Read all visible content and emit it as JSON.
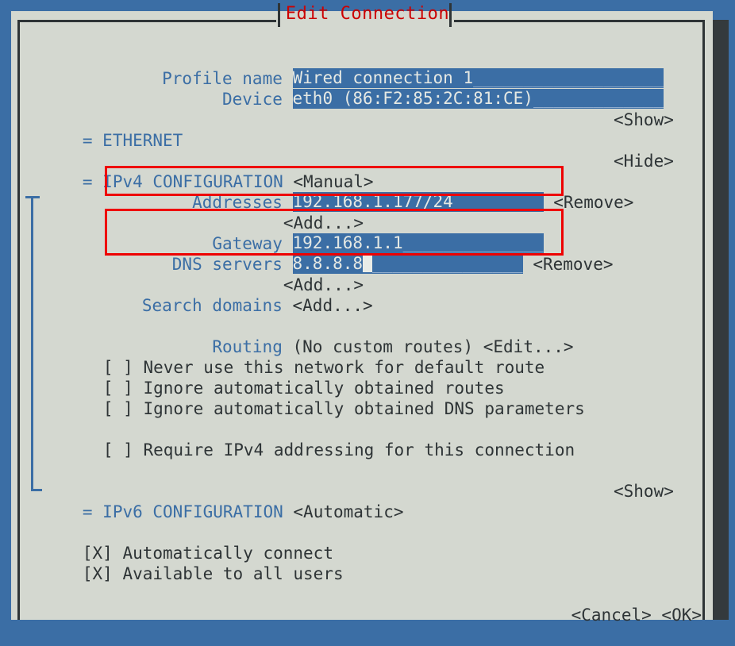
{
  "window": {
    "title": "Edit Connection",
    "app": "nmtui",
    "title_color": "#cc0000",
    "surface_color": "#d4d8d0",
    "accent_color": "#3b6ea5",
    "text_color": "#2e3436",
    "highlight_color": "#ee0000"
  },
  "form": {
    "profile_name": {
      "label": "Profile name",
      "value": "Wired connection 1",
      "fill": "___________________"
    },
    "device": {
      "label": "Device",
      "value": "eth0 (86:F2:85:2C:81:CE)",
      "fill": "_____________"
    }
  },
  "sections": {
    "ethernet": {
      "marker": "=",
      "title": "ETHERNET",
      "toggle": "<Show>"
    },
    "ipv4": {
      "marker": "=",
      "title": "IPv4 CONFIGURATION",
      "mode": "<Manual>",
      "toggle": "<Hide>",
      "addresses": {
        "label": "Addresses",
        "value": "192.168.1.177/24",
        "fill": "_________",
        "remove": "<Remove>",
        "add": "<Add...>"
      },
      "gateway": {
        "label": "Gateway",
        "value": "192.168.1.1",
        "fill": "______________"
      },
      "dns_servers": {
        "label": "DNS servers",
        "value": "8.8.8.8",
        "fill": "_______________",
        "remove": "<Remove>",
        "add": "<Add...>",
        "cursor_after_value": true
      },
      "search_domains": {
        "label": "Search domains",
        "add": "<Add...>"
      },
      "routing": {
        "label": "Routing",
        "value": "(No custom routes)",
        "edit": "<Edit...>"
      },
      "checkboxes": [
        {
          "box": "[ ]",
          "checked": false,
          "label": "Never use this network for default route"
        },
        {
          "box": "[ ]",
          "checked": false,
          "label": "Ignore automatically obtained routes"
        },
        {
          "box": "[ ]",
          "checked": false,
          "label": "Ignore automatically obtained DNS parameters"
        },
        {
          "box": "[ ]",
          "checked": false,
          "label": "Require IPv4 addressing for this connection"
        }
      ]
    },
    "ipv6": {
      "marker": "=",
      "title": "IPv6 CONFIGURATION",
      "mode": "<Automatic>",
      "toggle": "<Show>"
    }
  },
  "global_checkboxes": [
    {
      "box": "[X]",
      "checked": true,
      "label": "Automatically connect"
    },
    {
      "box": "[X]",
      "checked": true,
      "label": "Available to all users"
    }
  ],
  "actions": {
    "cancel": "<Cancel>",
    "ok": "<OK>"
  }
}
